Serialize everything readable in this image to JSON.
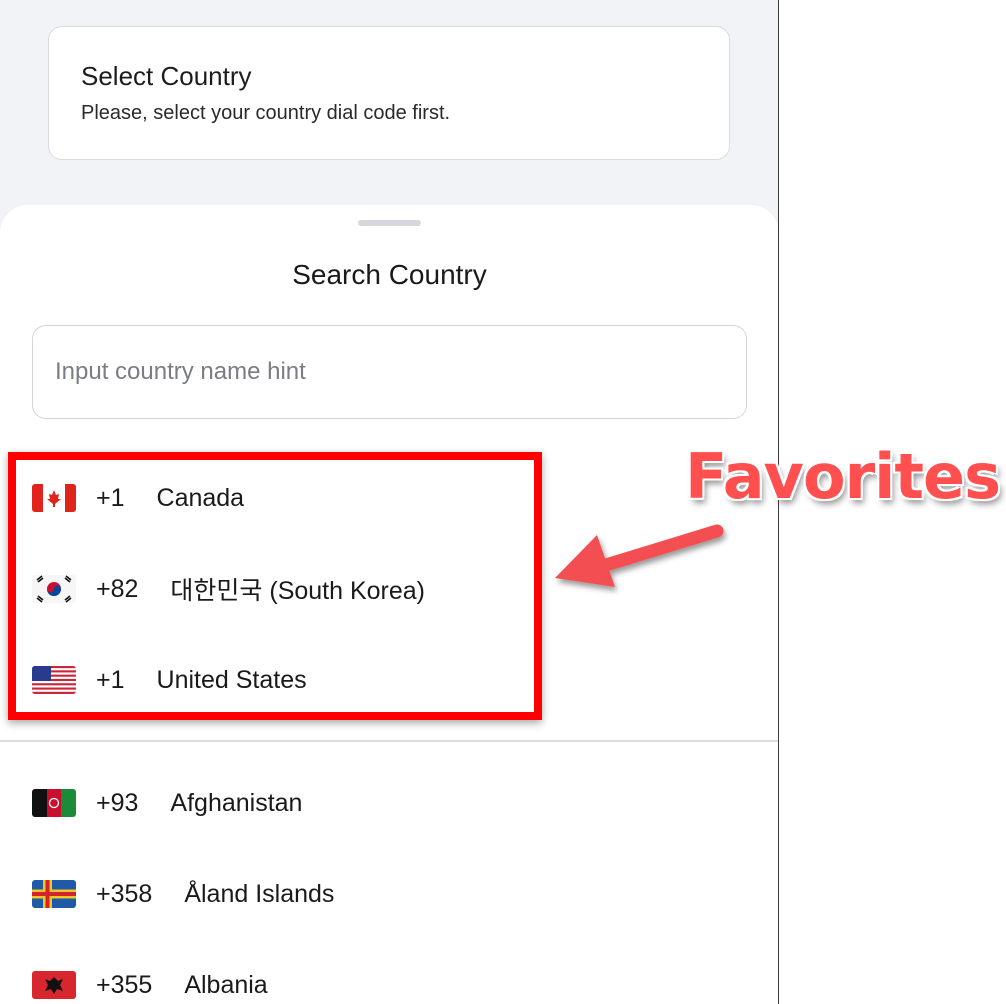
{
  "select_card": {
    "title": "Select Country",
    "subtitle": "Please, select your country dial code first."
  },
  "sheet": {
    "title": "Search Country",
    "search_placeholder": "Input country name hint"
  },
  "favorites": [
    {
      "flag": "canada-flag",
      "code": "+1",
      "name": "Canada"
    },
    {
      "flag": "south-korea-flag",
      "code": "+82",
      "name": "대한민국 (South Korea)"
    },
    {
      "flag": "united-states-flag",
      "code": "+1",
      "name": "United States"
    }
  ],
  "countries": [
    {
      "flag": "afghanistan-flag",
      "code": "+93",
      "name": "Afghanistan"
    },
    {
      "flag": "aland-islands-flag",
      "code": "+358",
      "name": "Åland Islands"
    },
    {
      "flag": "albania-flag",
      "code": "+355",
      "name": "Albania"
    }
  ],
  "annotation": {
    "label": "Favorites",
    "color": "#ff4f4f",
    "box_color": "#ff0000"
  }
}
